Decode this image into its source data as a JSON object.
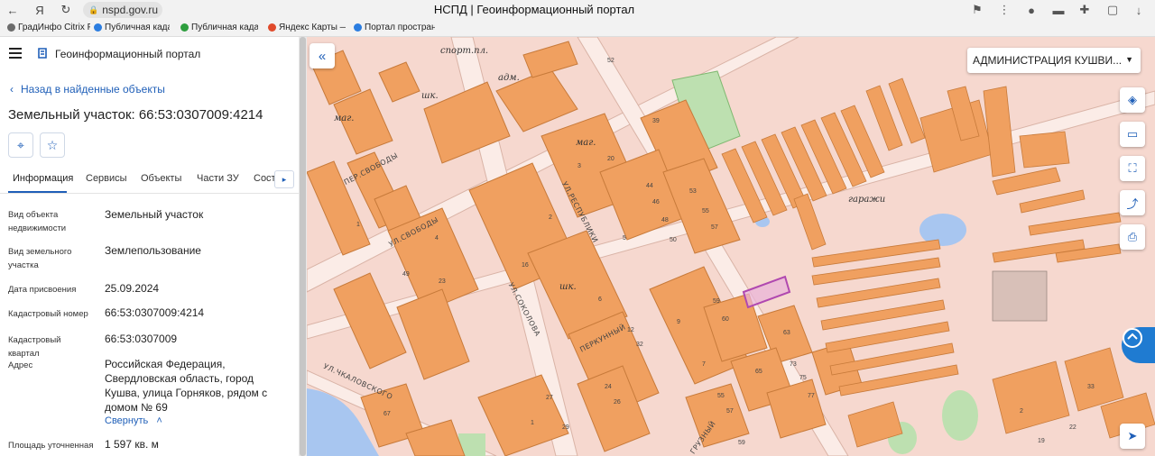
{
  "browser": {
    "url": "nspd.gov.ru",
    "tab_title": "НСПД | Геоинформационный портал",
    "bookmarks": [
      {
        "label": "ГрадИнфо Citrix F",
        "color": "#6b6b6b"
      },
      {
        "label": "Публичная кадас",
        "color": "#2b7de0"
      },
      {
        "label": "Публичная кадас",
        "color": "#2e9e3e"
      },
      {
        "label": "Яндекс Карты — т",
        "color": "#e04a2b"
      },
      {
        "label": "Портал простран",
        "color": "#2b7de0"
      }
    ]
  },
  "panel": {
    "app_title": "Геоинформационный портал",
    "back_label": "Назад в найденные объекты",
    "object_title": "Земельный участок: 66:53:0307009:4214",
    "tabs": [
      "Информация",
      "Сервисы",
      "Объекты",
      "Части ЗУ",
      "Соста"
    ],
    "active_tab": "Информация",
    "properties": [
      {
        "label": "Вид объекта недвижимости",
        "value": "Земельный участок"
      },
      {
        "label": "Вид земельного участка",
        "value": "Землепользование"
      },
      {
        "label": "Дата присвоения",
        "value": "25.09.2024"
      },
      {
        "label": "Кадастровый номер",
        "value": "66:53:0307009:4214"
      },
      {
        "label": "Кадастровый квартал",
        "value": "66:53:0307009"
      },
      {
        "label": "Адрес",
        "value": "Российская Федерация, Свердловская область, город Кушва, улица Горняков, рядом с домом № 69"
      },
      {
        "label": "Площадь уточненная",
        "value": "1 597 кв. м"
      }
    ],
    "collapse_label": "Свернуть"
  },
  "map": {
    "municipality": "АДМИНИСТРАЦИЯ КУШВИ...",
    "labels": {
      "sport": "спорт.пл.",
      "school1": "шк.",
      "adm": "адм.",
      "mag1": "маг.",
      "mag2": "маг.",
      "school2": "шк.",
      "garages": "гаражи"
    },
    "streets": {
      "svobody1": "ПЕР.СВОБОДЫ",
      "svobody2": "УЛ.СВОБОДЫ",
      "respubliki": "УЛ.РЕСПУБЛИКИ",
      "sakko": "УЛ.СОКОЛОВА",
      "perekupny": "ПЕРКУННЫЙ",
      "chkalova": "УЛ.ЧКАЛОВСКОГО",
      "gruzny": "ГРУЗНЫЙ"
    },
    "houses": [
      "52",
      "39",
      "3",
      "20",
      "2",
      "1",
      "4",
      "6",
      "8",
      "16",
      "5",
      "23",
      "49",
      "53",
      "55",
      "57",
      "44",
      "46",
      "48",
      "50",
      "9",
      "60",
      "12",
      "32",
      "59",
      "7",
      "55",
      "57",
      "59",
      "63",
      "65",
      "67",
      "73",
      "75",
      "77",
      "27",
      "29",
      "24",
      "26",
      "8",
      "9",
      "1",
      "2",
      "33",
      "19",
      "22"
    ],
    "colors": {
      "building": "#f0a060",
      "building_stroke": "#c77a3a",
      "base": "#f6d8cf",
      "road": "#fbece7",
      "water": "#a8c6f0",
      "park": "#bde0b0",
      "highlight": "#b048b0"
    }
  }
}
